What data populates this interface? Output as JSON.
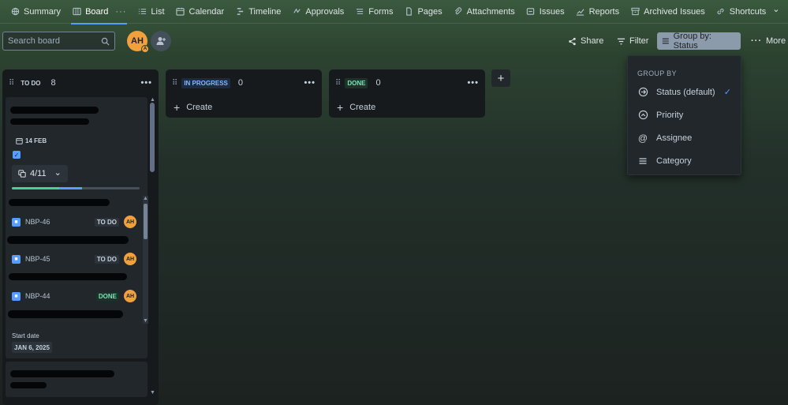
{
  "nav": {
    "tabs": [
      {
        "label": "Summary",
        "icon": "globe-icon"
      },
      {
        "label": "Board",
        "icon": "board-icon",
        "active": true
      },
      {
        "label": "List",
        "icon": "list-icon"
      },
      {
        "label": "Calendar",
        "icon": "calendar-icon"
      },
      {
        "label": "Timeline",
        "icon": "timeline-icon"
      },
      {
        "label": "Approvals",
        "icon": "approvals-icon"
      },
      {
        "label": "Forms",
        "icon": "forms-icon"
      },
      {
        "label": "Pages",
        "icon": "page-icon"
      },
      {
        "label": "Attachments",
        "icon": "paperclip-icon"
      },
      {
        "label": "Issues",
        "icon": "issues-icon"
      },
      {
        "label": "Reports",
        "icon": "chart-icon"
      },
      {
        "label": "Archived Issues",
        "icon": "archive-icon"
      },
      {
        "label": "Shortcuts",
        "icon": "link-icon"
      }
    ],
    "more_glyph": "···",
    "shortcuts_chevron": "⌄",
    "add_glyph": "+"
  },
  "toolbar": {
    "search_placeholder": "Search board",
    "avatar_initials": "AH",
    "avatar_sub": "A",
    "share_label": "Share",
    "filter_label": "Filter",
    "groupby_label": "Group by: Status",
    "more_label": "More"
  },
  "groupby_menu": {
    "header": "GROUP BY",
    "items": [
      {
        "label": "Status (default)",
        "icon": "arrow-circle-icon",
        "selected": true
      },
      {
        "label": "Priority",
        "icon": "priority-icon",
        "selected": false
      },
      {
        "label": "Assignee",
        "icon": "at-icon",
        "selected": false
      },
      {
        "label": "Category",
        "icon": "menu-lines-icon",
        "selected": false
      }
    ],
    "check_glyph": "✓"
  },
  "columns": [
    {
      "status": "TO DO",
      "count": "8",
      "menu": "•••"
    },
    {
      "status": "IN PROGRESS",
      "count": "0",
      "menu": "•••",
      "create_label": "Create"
    },
    {
      "status": "DONE",
      "count": "0",
      "menu": "•••",
      "create_label": "Create"
    }
  ],
  "add_column_glyph": "+",
  "todo_card": {
    "date": "14 FEB",
    "subtasks": "4/11",
    "subtask_progress": {
      "done": 0.37,
      "in_progress": 0.18
    },
    "children": [
      {
        "key": "NBP-46",
        "status": "TO DO",
        "assignee": "AH"
      },
      {
        "key": "NBP-45",
        "status": "TO DO",
        "assignee": "AH"
      },
      {
        "key": "NBP-44",
        "status": "DONE",
        "assignee": "AH"
      }
    ],
    "start_date_label": "Start date",
    "start_date_value": "JAN 6, 2025"
  },
  "colors": {
    "accent_blue": "#579dff",
    "done_green": "#4bce97",
    "avatar_orange": "#f0a13b"
  }
}
